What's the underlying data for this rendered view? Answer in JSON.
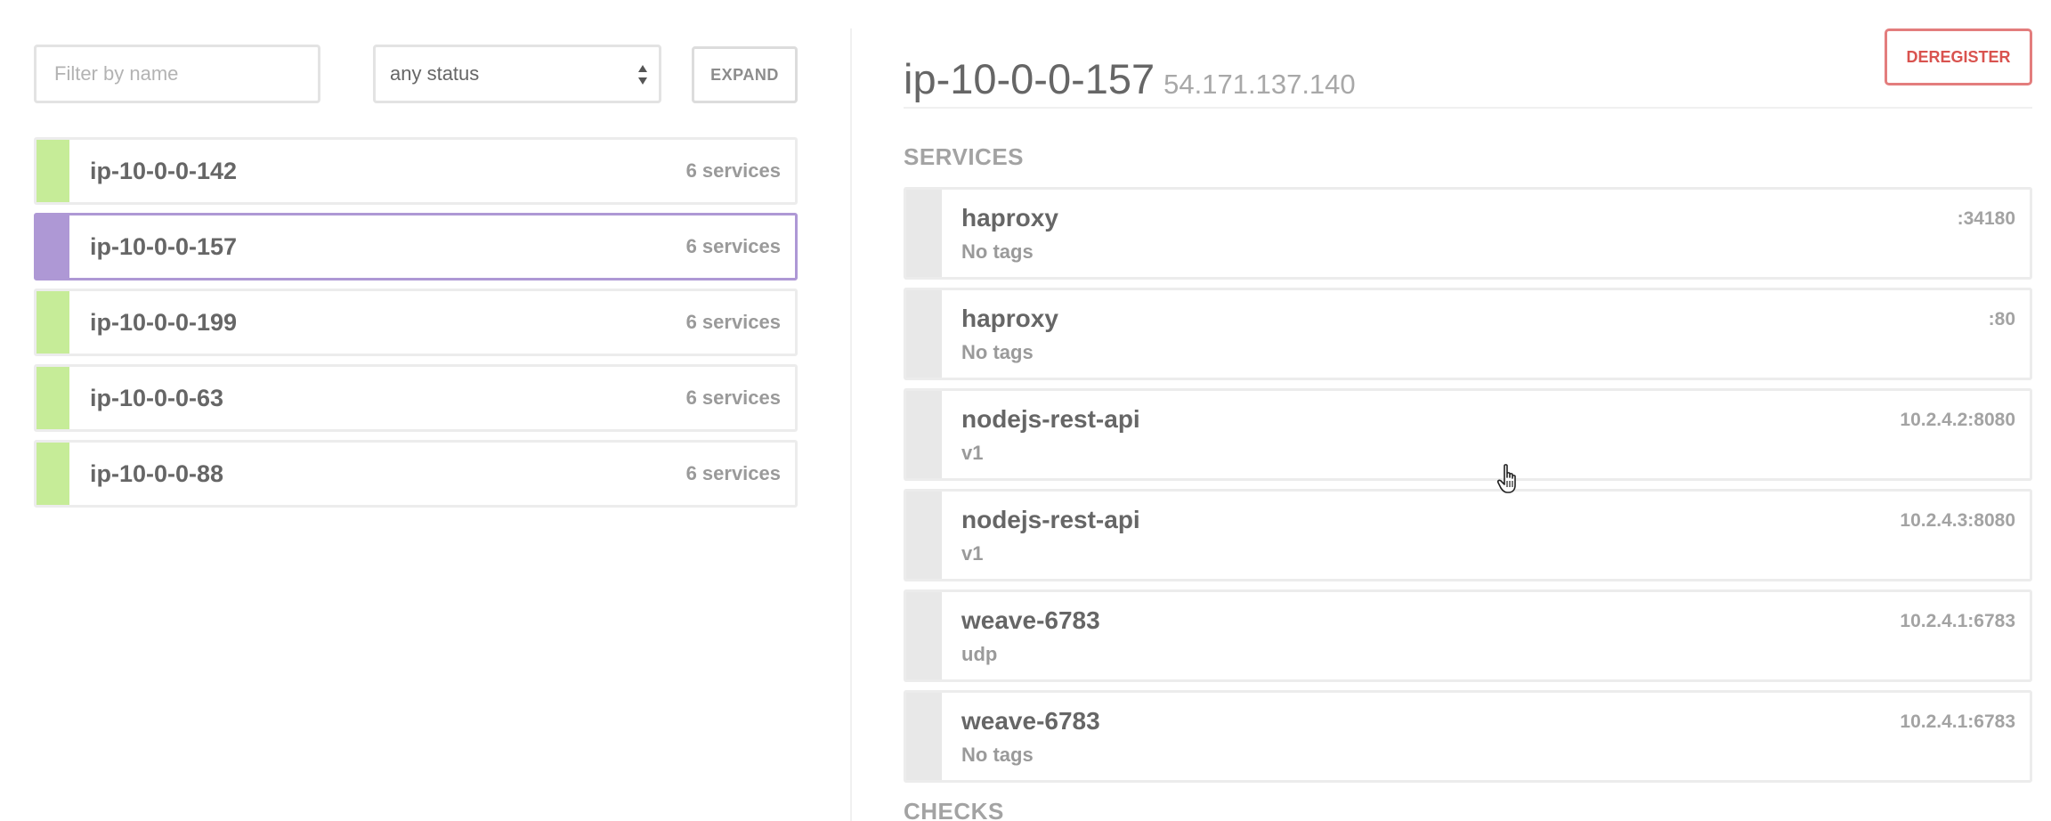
{
  "filters": {
    "name_placeholder": "Filter by name",
    "name_value": "",
    "status_selected": "any status",
    "expand_label": "EXPAND"
  },
  "colors": {
    "passing": "#c6ec98",
    "selected": "#ae98d5",
    "deregister": "#d9534f"
  },
  "nodes": [
    {
      "name": "ip-10-0-0-142",
      "services": "6 services",
      "status": "passing"
    },
    {
      "name": "ip-10-0-0-157",
      "services": "6 services",
      "status": "selected"
    },
    {
      "name": "ip-10-0-0-199",
      "services": "6 services",
      "status": "passing"
    },
    {
      "name": "ip-10-0-0-63",
      "services": "6 services",
      "status": "passing"
    },
    {
      "name": "ip-10-0-0-88",
      "services": "6 services",
      "status": "passing"
    }
  ],
  "detail": {
    "node_name": "ip-10-0-0-157",
    "node_address": "54.171.137.140",
    "deregister_label": "DEREGISTER",
    "services_title": "SERVICES",
    "checks_title": "CHECKS",
    "services": [
      {
        "name": "haproxy",
        "tags": "No tags",
        "port": ":34180"
      },
      {
        "name": "haproxy",
        "tags": "No tags",
        "port": ":80"
      },
      {
        "name": "nodejs-rest-api",
        "tags": "v1",
        "port": "10.2.4.2:8080"
      },
      {
        "name": "nodejs-rest-api",
        "tags": "v1",
        "port": "10.2.4.3:8080"
      },
      {
        "name": "weave-6783",
        "tags": "udp",
        "port": "10.2.4.1:6783"
      },
      {
        "name": "weave-6783",
        "tags": "No tags",
        "port": "10.2.4.1:6783"
      }
    ]
  },
  "icons": {
    "select_arrows": "up-down-arrows-icon",
    "cursor": "hand-pointer-icon"
  }
}
